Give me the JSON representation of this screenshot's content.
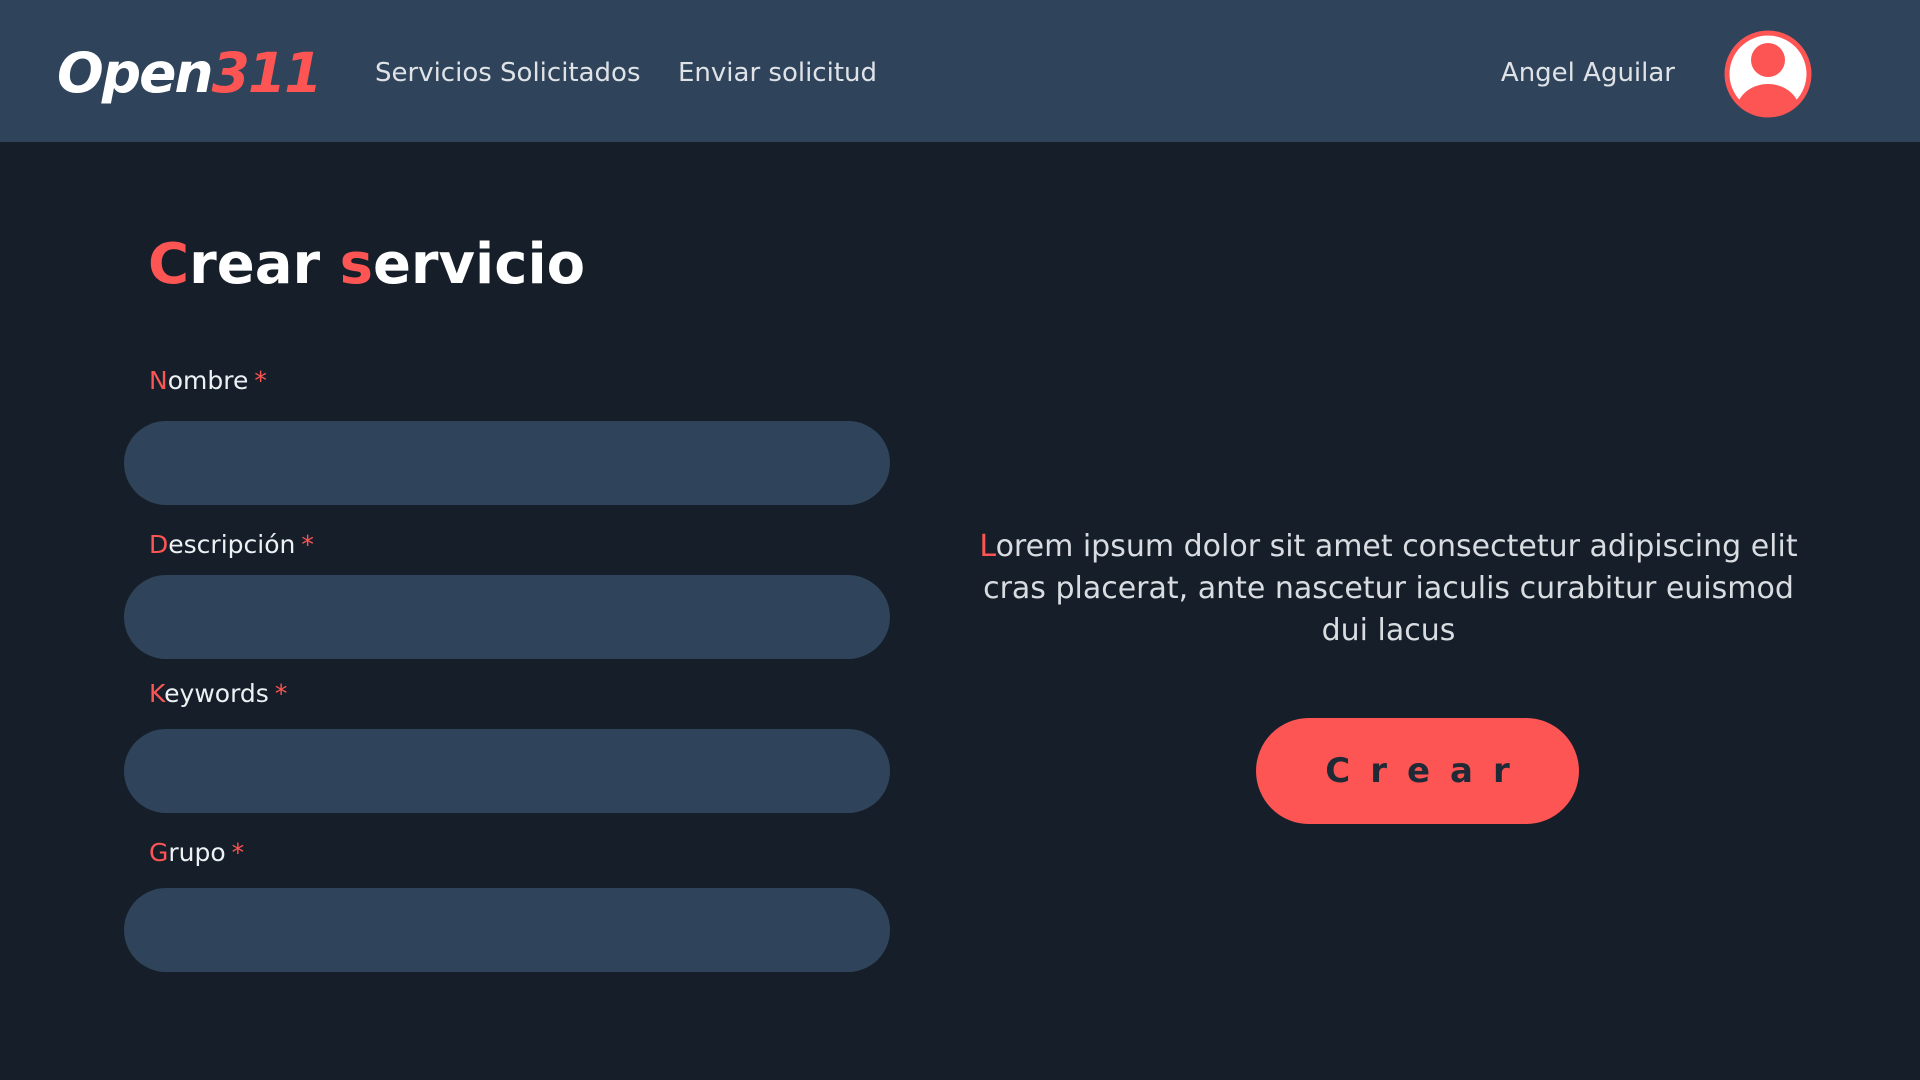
{
  "header": {
    "logo": {
      "part1": "Open",
      "part2": "311"
    },
    "nav": [
      {
        "label": "Servicios Solicitados"
      },
      {
        "label": "Enviar solicitud"
      }
    ],
    "user_name": "Angel Aguilar",
    "avatar_icon": "user-circle-icon"
  },
  "page": {
    "title": {
      "c1": "C",
      "t1": "rear ",
      "c2": "s",
      "t2": "ervicio"
    }
  },
  "form": {
    "fields": [
      {
        "first": "N",
        "rest": "ombre",
        "required": "*",
        "value": "",
        "placeholder": ""
      },
      {
        "first": "D",
        "rest": "escripción",
        "required": "*",
        "value": "",
        "placeholder": ""
      },
      {
        "first": "K",
        "rest": "eywords",
        "required": "*",
        "value": "",
        "placeholder": ""
      },
      {
        "first": "G",
        "rest": "rupo",
        "required": "*",
        "value": "",
        "placeholder": ""
      }
    ]
  },
  "side": {
    "description": {
      "first": "L",
      "rest": "orem ipsum dolor sit amet consectetur adipiscing elit cras placerat, ante nascetur iaculis curabitur euismod dui lacus"
    },
    "create_button": "Crear"
  },
  "colors": {
    "background": "#161f29",
    "header": "#2f445a",
    "accent": "#fd5454",
    "input": "#2f445a"
  }
}
